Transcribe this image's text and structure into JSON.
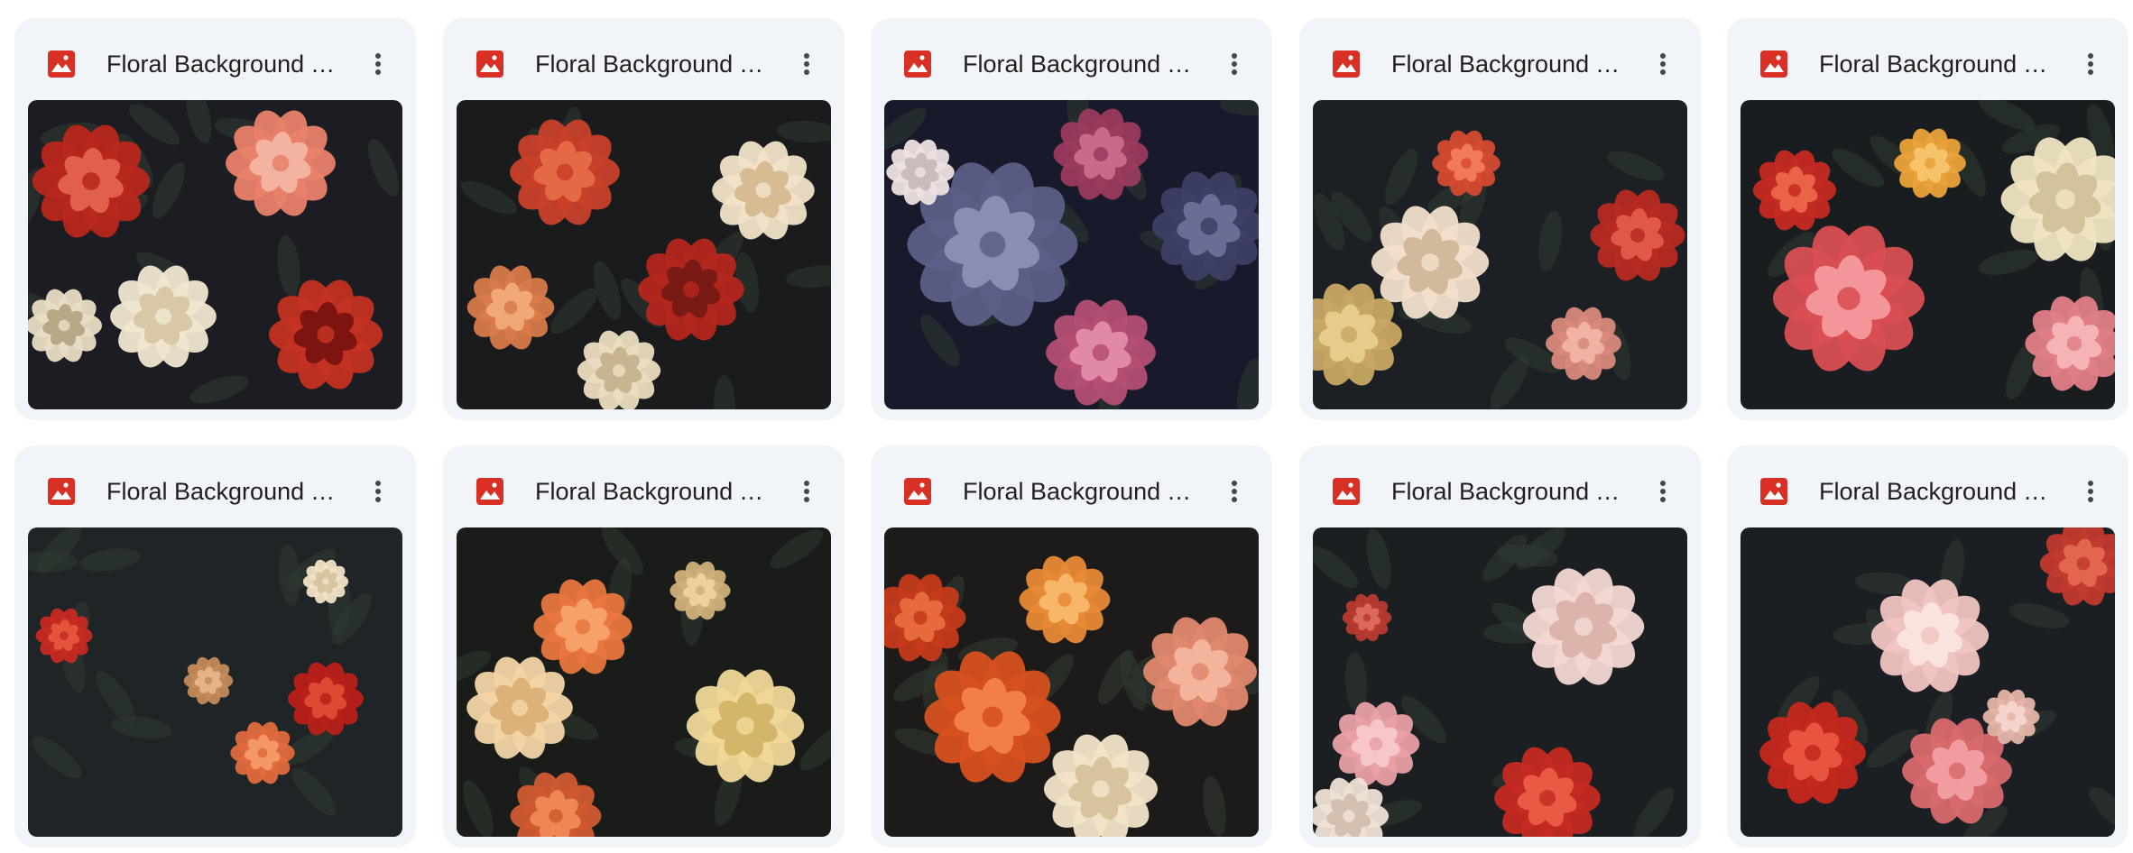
{
  "files": [
    {
      "name": "Floral Background T...",
      "icon": "image-file-icon",
      "bg": "#1b1d22",
      "flowers": [
        [
          "#b8261c",
          "#e0604c"
        ],
        [
          "#e8816a",
          "#f3b3a0"
        ],
        [
          "#f0e6d0",
          "#d8c8a8"
        ],
        [
          "#c23222",
          "#7e1410"
        ],
        [
          "#e9dcc4",
          "#b7a888"
        ]
      ]
    },
    {
      "name": "Floral Background T...",
      "icon": "image-file-icon",
      "bg": "#1a1b1d",
      "flowers": [
        [
          "#c8402a",
          "#e36a45"
        ],
        [
          "#f1e2c8",
          "#d6bb93"
        ],
        [
          "#b3261c",
          "#7a1a14"
        ],
        [
          "#d87a4a",
          "#f0a878"
        ],
        [
          "#eadcc0",
          "#c8b490"
        ]
      ]
    },
    {
      "name": "Floral Background T...",
      "icon": "image-file-icon",
      "bg": "#18192a",
      "flowers": [
        [
          "#5c5f86",
          "#8a8eb5"
        ],
        [
          "#9a3a5e",
          "#c86a8c"
        ],
        [
          "#3d3f63",
          "#6a6d96"
        ],
        [
          "#b44e74",
          "#e08aa8"
        ],
        [
          "#ece2e0",
          "#c9bcbc"
        ]
      ]
    },
    {
      "name": "Floral Background T...",
      "icon": "image-file-icon",
      "bg": "#1c2024",
      "flowers": [
        [
          "#d44a32",
          "#f07a5a"
        ],
        [
          "#f1dfcc",
          "#d2b89c"
        ],
        [
          "#b82a22",
          "#e05848"
        ],
        [
          "#d8897c",
          "#f0b2a4"
        ],
        [
          "#c8a864",
          "#e6cc8c"
        ]
      ]
    },
    {
      "name": "Floral Background T...",
      "icon": "image-file-icon",
      "bg": "#1a1d1f",
      "flowers": [
        [
          "#d84e52",
          "#f4959a"
        ],
        [
          "#e9a23a",
          "#f6c36a"
        ],
        [
          "#efe4c2",
          "#d3c39a"
        ],
        [
          "#c42a22",
          "#ea6248"
        ],
        [
          "#e07e86",
          "#f6b3b6"
        ]
      ]
    },
    {
      "name": "Floral Background T...",
      "icon": "image-file-icon",
      "bg": "#1f2427",
      "flowers": [
        [
          "#c62a22",
          "#e4543c"
        ],
        [
          "#f0e2c6",
          "#d8c49e"
        ],
        [
          "#e06a3c",
          "#f49868"
        ],
        [
          "#c48a5a",
          "#e4b488"
        ],
        [
          "#b82018",
          "#dc4a34"
        ]
      ]
    },
    {
      "name": "Floral Background T...",
      "icon": "image-file-icon",
      "bg": "#1a1c1a",
      "flowers": [
        [
          "#e8763e",
          "#f8a06a"
        ],
        [
          "#f2d4a4",
          "#dcb27a"
        ],
        [
          "#efd898",
          "#d4b66a"
        ],
        [
          "#cf5a30",
          "#ee8656"
        ],
        [
          "#d0b07a",
          "#ecd09e"
        ]
      ]
    },
    {
      "name": "Floral Background T...",
      "icon": "image-file-icon",
      "bg": "#1d1b19",
      "flowers": [
        [
          "#d6501e",
          "#f28046"
        ],
        [
          "#e88a36",
          "#f8b66a"
        ],
        [
          "#f1e4c8",
          "#d8c49c"
        ],
        [
          "#c43a1a",
          "#e66a3e"
        ],
        [
          "#e0886e",
          "#f4b49c"
        ]
      ]
    },
    {
      "name": "Floral Background T...",
      "icon": "image-file-icon",
      "bg": "#1c1f22",
      "flowers": [
        [
          "#f2d8d2",
          "#dcb4ac"
        ],
        [
          "#c42a22",
          "#e85a44"
        ],
        [
          "#e8a0a4",
          "#f6c6c8"
        ],
        [
          "#b83a30",
          "#dc6a5a"
        ],
        [
          "#efe0d4",
          "#d4c0b0"
        ]
      ]
    },
    {
      "name": "Floral Background T...",
      "icon": "image-file-icon",
      "bg": "#1b1e22",
      "flowers": [
        [
          "#f0c4c0",
          "#fae2de"
        ],
        [
          "#c4281e",
          "#e85440"
        ],
        [
          "#d86a6e",
          "#f09ca0"
        ],
        [
          "#e4b4a8",
          "#f4d4cc"
        ],
        [
          "#c23a2e",
          "#e2664e"
        ]
      ]
    }
  ]
}
